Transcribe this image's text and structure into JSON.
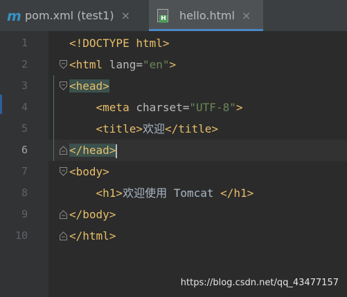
{
  "tabs": [
    {
      "label": "pom.xml (test1)",
      "icon": "maven-m-icon"
    },
    {
      "label": "hello.html",
      "icon": "html-file-icon",
      "active": true
    }
  ],
  "close_glyph": "×",
  "line_numbers": [
    "1",
    "2",
    "3",
    "4",
    "5",
    "6",
    "7",
    "8",
    "9",
    "10"
  ],
  "active_line": "6",
  "code": {
    "l1": {
      "tag": "<!DOCTYPE html>"
    },
    "l2": {
      "open": "<html",
      "attr": " lang=",
      "val": "\"en\"",
      "close": ">"
    },
    "l3": {
      "tag": "<head>"
    },
    "l4": {
      "open": "<meta",
      "attr": " charset=",
      "val": "\"UTF-8\"",
      "close": ">"
    },
    "l5": {
      "open": "<title>",
      "text": "欢迎",
      "close": "</title>"
    },
    "l6": {
      "tag": "</head>"
    },
    "l7": {
      "tag": "<body>"
    },
    "l8": {
      "open": "<h1>",
      "text": "欢迎使用 Tomcat ",
      "close": "</h1>"
    },
    "l9": {
      "tag": "</body>"
    },
    "l10": {
      "tag": "</html>"
    }
  },
  "watermark": "https://blog.csdn.net/qq_43477157",
  "colors": {
    "tag": "#e8bf6a",
    "attribute": "#bababa",
    "string": "#6a8759",
    "text": "#a9b7c6",
    "background": "#2b2b2b",
    "active_tab_underline": "#4a88c7"
  }
}
